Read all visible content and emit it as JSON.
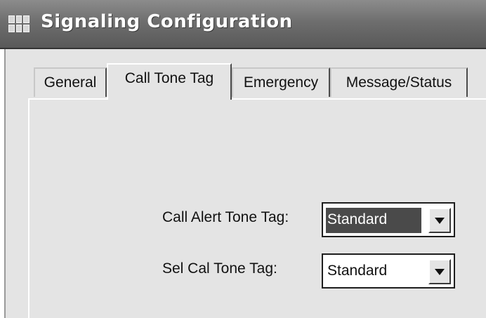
{
  "window": {
    "title": "Signaling Configuration",
    "icon": "window-grid-icon"
  },
  "tabs": [
    {
      "label": "General",
      "active": false
    },
    {
      "label": "Call Tone Tag",
      "active": true
    },
    {
      "label": "Emergency",
      "active": false
    },
    {
      "label": "Message/Status",
      "active": false
    }
  ],
  "form": {
    "call_alert": {
      "label": "Call Alert Tone Tag:",
      "value": "Standard",
      "icon": "chevron-down-icon"
    },
    "sel_cal": {
      "label": "Sel Cal Tone Tag:",
      "value": "Standard",
      "icon": "chevron-down-icon"
    }
  },
  "colors": {
    "titlebar": "#6e6e6e",
    "body": "#e4e4e4",
    "selection": "#4a4a4a"
  }
}
